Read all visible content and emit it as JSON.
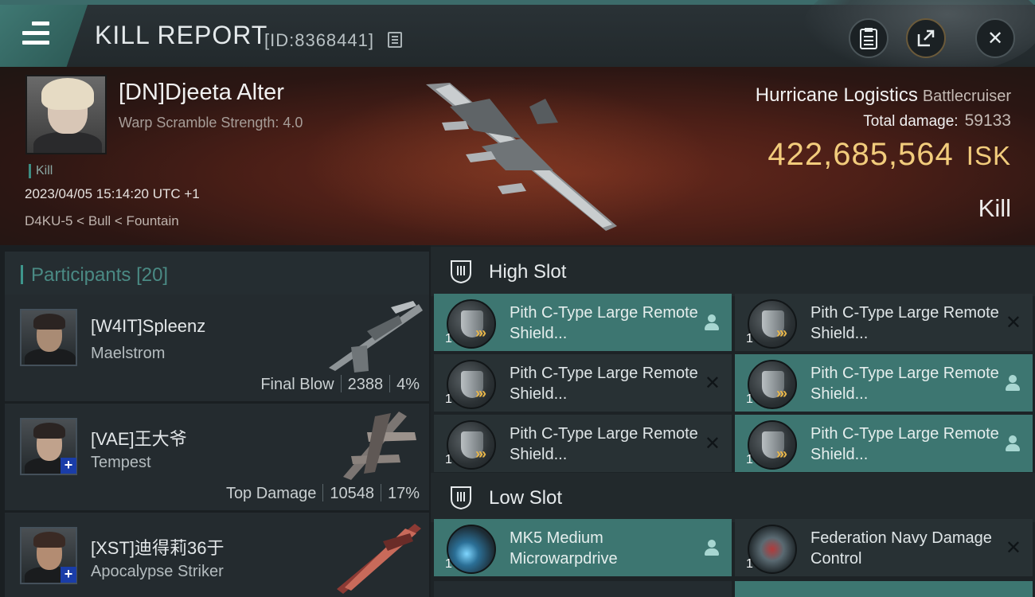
{
  "header": {
    "title": "KILL REPORT",
    "report_id": "[ID:8368441]"
  },
  "victim": {
    "name": "[DN]Djeeta Alter",
    "warp_scramble": "Warp Scramble Strength: 4.0",
    "status_tag": "Kill",
    "timestamp": "2023/04/05 15:14:20 UTC +1",
    "location": "D4KU-5 < Bull < Fountain",
    "ship": "Hurricane Logistics",
    "ship_class": "Battlecruiser",
    "total_damage_label": "Total damage:",
    "total_damage": "59133",
    "isk_value": "422,685,564",
    "isk_unit": "ISK",
    "result": "Kill"
  },
  "participants": {
    "title": "Participants",
    "count": "[20]",
    "rows": [
      {
        "name": "[W4IT]Spleenz",
        "ship": "Maelstrom",
        "role": "Final Blow",
        "damage": "2388",
        "percent": "4%"
      },
      {
        "name": "[VAE]王大爷",
        "ship": "Tempest",
        "role": "Top Damage",
        "damage": "10548",
        "percent": "17%"
      },
      {
        "name": "[XST]迪得莉36于",
        "ship": "Apocalypse Striker"
      }
    ]
  },
  "slots": {
    "high": {
      "title": "High Slot",
      "modules": [
        {
          "qty": "1",
          "name": "Pith C-Type Large Remote Shield...",
          "state": "fitted"
        },
        {
          "qty": "1",
          "name": "Pith C-Type Large Remote Shield...",
          "state": "destroyed"
        },
        {
          "qty": "1",
          "name": "Pith C-Type Large Remote Shield...",
          "state": "destroyed"
        },
        {
          "qty": "1",
          "name": "Pith C-Type Large Remote Shield...",
          "state": "fitted"
        },
        {
          "qty": "1",
          "name": "Pith C-Type Large Remote Shield...",
          "state": "destroyed"
        },
        {
          "qty": "1",
          "name": "Pith C-Type Large Remote Shield...",
          "state": "fitted"
        }
      ]
    },
    "low": {
      "title": "Low Slot",
      "modules": [
        {
          "qty": "1",
          "name": "MK5 Medium Microwarpdrive",
          "state": "fitted"
        },
        {
          "qty": "1",
          "name": "Federation Navy Damage Control",
          "state": "destroyed"
        }
      ]
    }
  },
  "colors": {
    "accent": "#3d7671",
    "isk": "#f2cc7c",
    "banner": "#4c1f17"
  }
}
